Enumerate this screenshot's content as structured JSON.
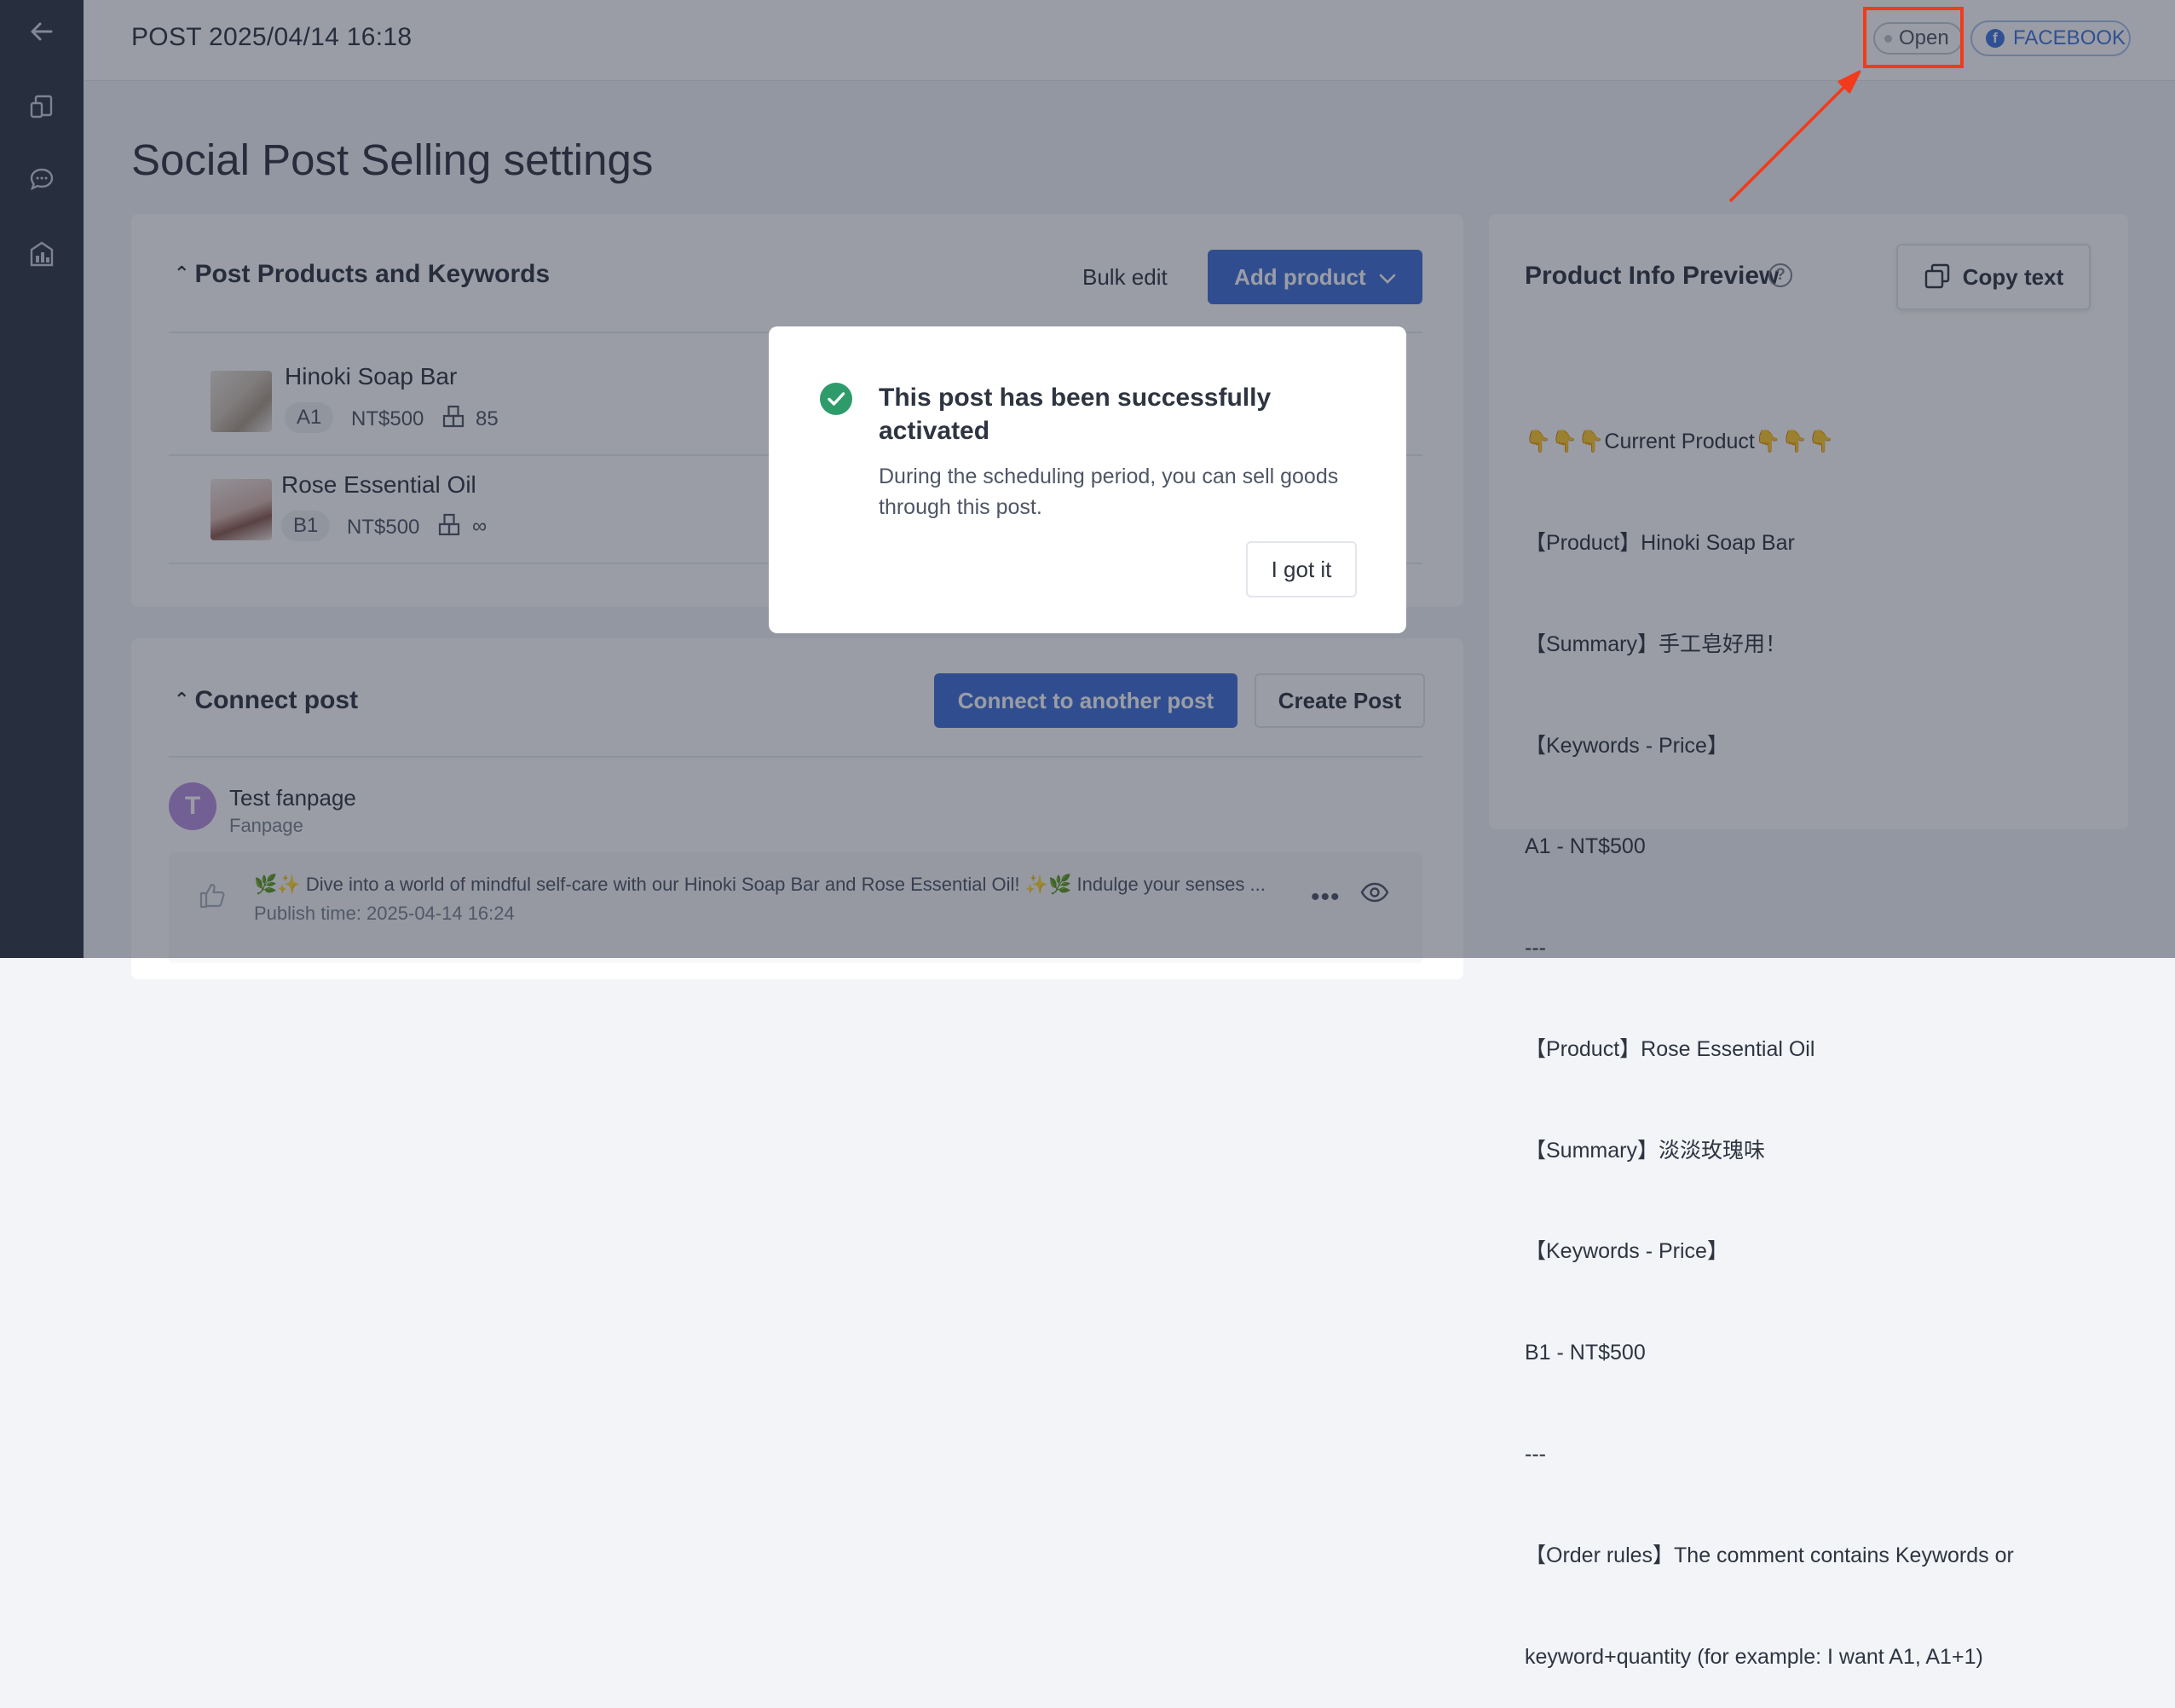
{
  "header": {
    "title": "POST 2025/04/14 16:18",
    "status": "Open",
    "platform": "FACEBOOK"
  },
  "page_title": "Social Post Selling settings",
  "products_section": {
    "title": "Post Products and Keywords",
    "bulk_edit": "Bulk edit",
    "add_product": "Add product",
    "items": [
      {
        "name": "Hinoki Soap Bar",
        "keyword": "A1",
        "price": "NT$500",
        "stock": "85"
      },
      {
        "name": "Rose Essential Oil",
        "keyword": "B1",
        "price": "NT$500",
        "stock": "∞"
      }
    ]
  },
  "connect_section": {
    "title": "Connect post",
    "connect_button": "Connect to another post",
    "create_button": "Create Post",
    "page_initial": "T",
    "page_name": "Test fanpage",
    "page_type": "Fanpage",
    "post_excerpt": "🌿✨ Dive into a world of mindful self-care with our Hinoki Soap Bar and Rose Essential Oil! ✨🌿 Indulge your senses ...",
    "publish_time": "Publish time: 2025-04-14 16:24"
  },
  "preview": {
    "title": "Product Info Preview",
    "copy_text": "Copy text",
    "lines": [
      "👇👇👇Current Product👇👇👇",
      "【Product】Hinoki Soap Bar",
      "【Summary】手工皂好用！",
      "【Keywords - Price】",
      "A1 - NT$500",
      "---",
      "【Product】Rose Essential Oil",
      "【Summary】淡淡玫瑰味",
      "【Keywords - Price】",
      "B1 - NT$500",
      "---",
      "【Order rules】The comment contains Keywords or",
      "keyword+quantity (for example: I want A1, A1+1)"
    ]
  },
  "modal": {
    "title": "This post has been successfully activated",
    "description": "During the scheduling period, you can sell goods through this post.",
    "button": "I got it"
  },
  "colors": {
    "primary": "#3f6fd8",
    "success": "#2e9b6a",
    "highlight": "#f23a1c",
    "sidebar": "#2f3644",
    "avatar": "#b68ee0"
  }
}
